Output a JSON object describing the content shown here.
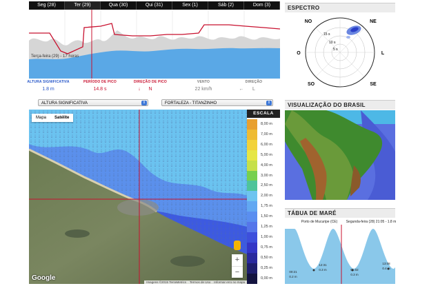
{
  "days": [
    "Seg (28)",
    "Ter (29)",
    "Qua (30)",
    "Qui (31)",
    "Sex (1)",
    "Sáb (2)",
    "Dom (3)"
  ],
  "selected_day_index": 1,
  "current_time_label": "Terça-feira (29) - 17 horas",
  "params": [
    {
      "label": "ALTURA SIGNIFICATIVA",
      "value": "1.8 m",
      "color": "#2253c8"
    },
    {
      "label": "PERÍODO DE PICO",
      "value": "14.8 s",
      "color": "#c8102e"
    },
    {
      "label": "DIREÇÃO DE PICO",
      "value": "N",
      "color": "#c8102e"
    },
    {
      "label": "VENTO",
      "value": "22 km/h",
      "color": "#777777"
    },
    {
      "label": "DIREÇÃO",
      "value": "L",
      "color": "#777777"
    }
  ],
  "dropdowns": {
    "variable": "ALTURA SIGNIFICATIVA",
    "location": "FORTALEZA - TITANZINHO"
  },
  "map": {
    "type_buttons": [
      "Mapa",
      "Satélite"
    ],
    "logo": "Google",
    "attribution": [
      "Imagens ©2015 TerraMetrics",
      "Termos de Uso",
      "Informar erro no mapa"
    ],
    "zoom_in": "+",
    "zoom_out": "−"
  },
  "scale": {
    "title": "ESCALA",
    "levels": [
      {
        "label": "8,00 m",
        "color": "#e8a030"
      },
      {
        "label": "7,00 m",
        "color": "#eebb33"
      },
      {
        "label": "6,00 m",
        "color": "#f2d23a"
      },
      {
        "label": "5,00 m",
        "color": "#e6e645"
      },
      {
        "label": "4,00 m",
        "color": "#c6e04a"
      },
      {
        "label": "3,00 m",
        "color": "#77d04e"
      },
      {
        "label": "2,50 m",
        "color": "#4fc49a"
      },
      {
        "label": "2,00 m",
        "color": "#6ec4f0"
      },
      {
        "label": "1,75 m",
        "color": "#62a8f2"
      },
      {
        "label": "1,50 m",
        "color": "#5a8ef0"
      },
      {
        "label": "1,25 m",
        "color": "#5576ea"
      },
      {
        "label": "1,00 m",
        "color": "#3d4fdc"
      },
      {
        "label": "0,75 m",
        "color": "#3436c6"
      },
      {
        "label": "0,50 m",
        "color": "#2a2a9e"
      },
      {
        "label": "0,25 m",
        "color": "#1f1f6e"
      },
      {
        "label": "0,00 m",
        "color": "#141440"
      }
    ]
  },
  "spectrum": {
    "title": "ESPECTRO",
    "dirs": [
      "NO",
      "NE",
      "O",
      "L",
      "SO",
      "SE"
    ],
    "rings": [
      "15 s",
      "10 s",
      "5 s"
    ]
  },
  "brazil": {
    "title": "VISUALIZAÇÃO DO BRASIL"
  },
  "tide": {
    "title": "TÁBUA DE MARÉ",
    "port": "Porto de Mucuripe (CE)",
    "day_label": "Segunda-feira (28) 21:05 - 1.8 m",
    "faded_labels": [
      "nda-feira",
      "Terça-feira"
    ],
    "lows": [
      {
        "time": "00:21",
        "height": "0.2 m"
      },
      {
        "time": "12:31",
        "height": "0.3 m"
      },
      {
        "time": "01:02",
        "height": "0.3 m"
      },
      {
        "time": "13:08",
        "height": "0.4 m"
      }
    ]
  }
}
